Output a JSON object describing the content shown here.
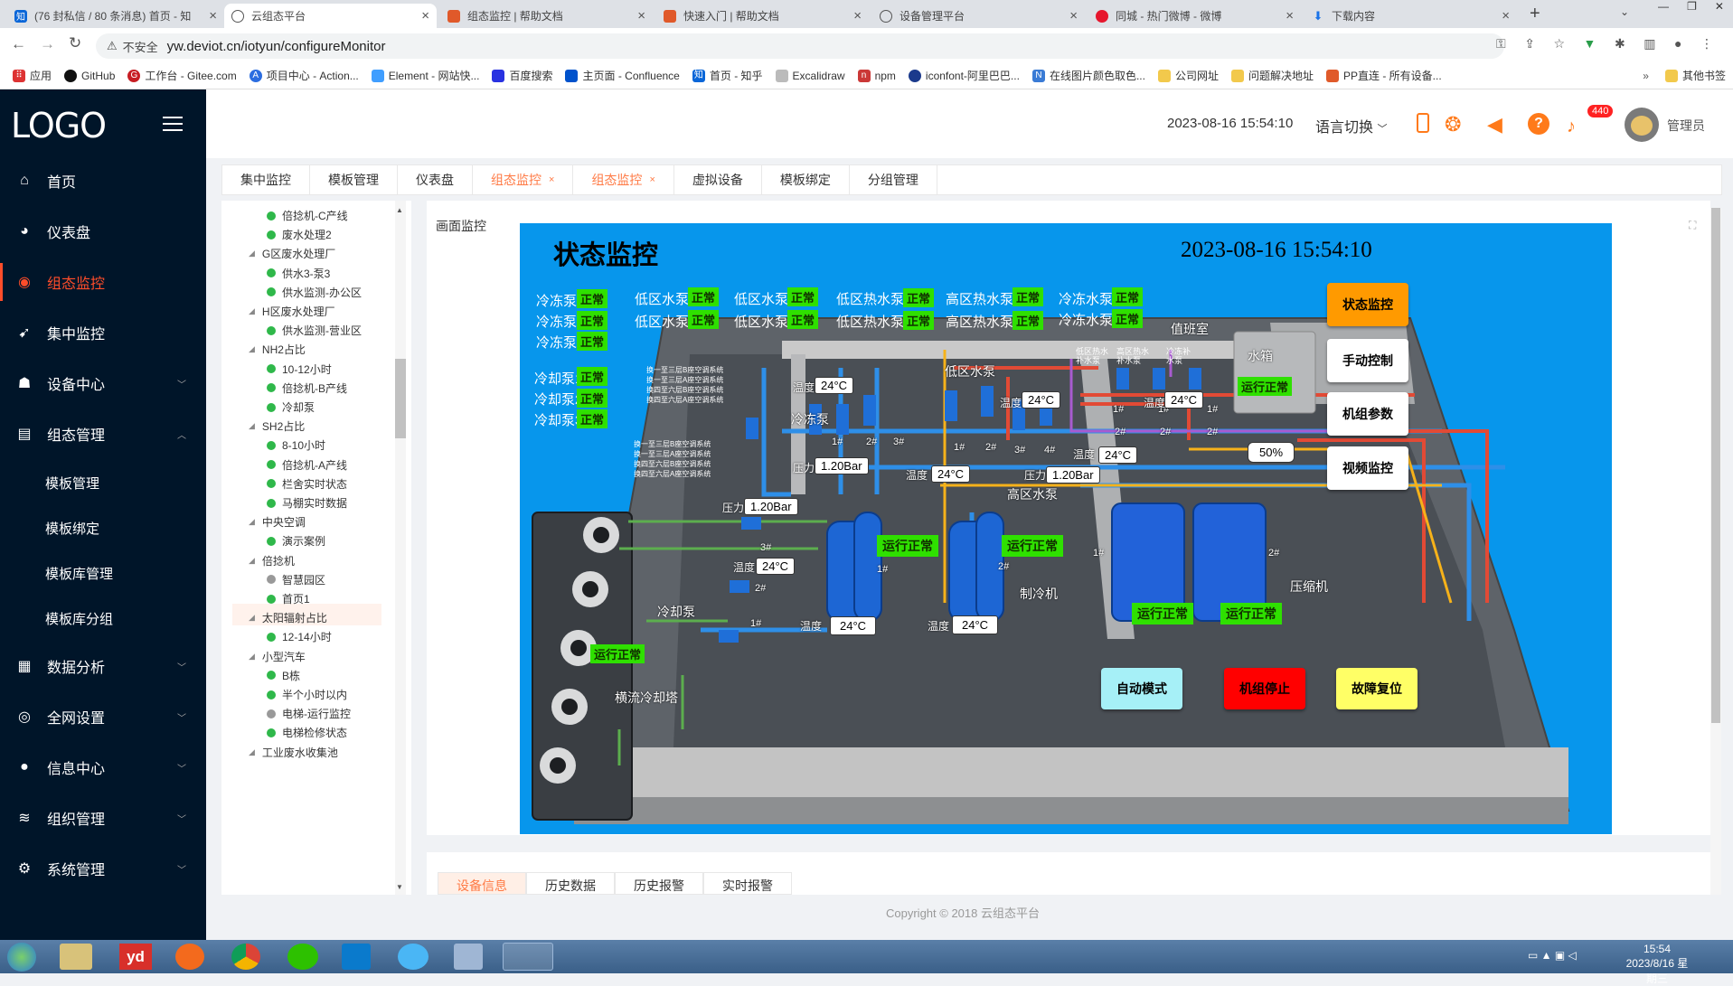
{
  "browser": {
    "tabs": [
      {
        "label": "(76 封私信 / 80 条消息) 首页 - 知",
        "active": false
      },
      {
        "label": "云组态平台",
        "active": true
      },
      {
        "label": "组态监控 | 帮助文档",
        "active": false
      },
      {
        "label": "快速入门 | 帮助文档",
        "active": false
      },
      {
        "label": "设备管理平台",
        "active": false
      },
      {
        "label": "同城 - 热门微博 - 微博",
        "active": false
      },
      {
        "label": "下载内容",
        "active": false
      }
    ],
    "security": "不安全",
    "url": "yw.deviot.cn/iotyun/configureMonitor",
    "bookmarks": [
      "应用",
      "GitHub",
      "工作台 - Gitee.com",
      "项目中心 - Action...",
      "Element - 网站快...",
      "百度搜索",
      "主页面 - Confluence",
      "首页 - 知乎",
      "Excalidraw",
      "npm",
      "iconfont-阿里巴巴...",
      "在线图片颜色取色...",
      "公司网址",
      "问题解决地址",
      "PP直连 - 所有设备..."
    ],
    "bookmarks_other": "其他书签"
  },
  "sidebar": {
    "logo": "LOGO",
    "items": [
      {
        "label": "首页",
        "icon": "home-icon"
      },
      {
        "label": "仪表盘",
        "icon": "dashboard-icon"
      },
      {
        "label": "组态监控",
        "icon": "monitor-icon"
      },
      {
        "label": "集中监控",
        "icon": "central-monitor-icon"
      },
      {
        "label": "设备中心",
        "icon": "device-icon"
      },
      {
        "label": "组态管理",
        "icon": "config-icon"
      },
      {
        "label": "数据分析",
        "icon": "analysis-icon"
      },
      {
        "label": "全网设置",
        "icon": "network-icon"
      },
      {
        "label": "信息中心",
        "icon": "message-icon"
      },
      {
        "label": "组织管理",
        "icon": "org-icon"
      },
      {
        "label": "系统管理",
        "icon": "settings-icon"
      }
    ],
    "subitems": [
      "模板管理",
      "模板绑定",
      "模板库管理",
      "模板库分组"
    ]
  },
  "header": {
    "datetime": "2023-08-16 15:54:10",
    "language": "语言切换",
    "badge": "440",
    "user": "管理员"
  },
  "tags": [
    {
      "label": "集中监控",
      "closable": false,
      "hl": false
    },
    {
      "label": "模板管理",
      "closable": false,
      "hl": false
    },
    {
      "label": "仪表盘",
      "closable": false,
      "hl": false
    },
    {
      "label": "组态监控",
      "closable": true,
      "hl": true
    },
    {
      "label": "组态监控",
      "closable": true,
      "hl": true
    },
    {
      "label": "虚拟设备",
      "closable": false,
      "hl": false
    },
    {
      "label": "模板绑定",
      "closable": false,
      "hl": false
    },
    {
      "label": "分组管理",
      "closable": false,
      "hl": false
    }
  ],
  "tree": [
    {
      "t": "倍捻机-C产线",
      "lv": 2,
      "dot": "green"
    },
    {
      "t": "废水处理2",
      "lv": 2,
      "dot": "green"
    },
    {
      "t": "G区废水处理厂",
      "lv": 1
    },
    {
      "t": "供水3-泵3",
      "lv": 2,
      "dot": "green"
    },
    {
      "t": "供水监测-办公区",
      "lv": 2,
      "dot": "green"
    },
    {
      "t": "H区废水处理厂",
      "lv": 1
    },
    {
      "t": "供水监测-营业区",
      "lv": 2,
      "dot": "green"
    },
    {
      "t": "NH2占比",
      "lv": 1
    },
    {
      "t": "10-12小时",
      "lv": 2,
      "dot": "green"
    },
    {
      "t": "倍捻机-B产线",
      "lv": 2,
      "dot": "green"
    },
    {
      "t": "冷却泵",
      "lv": 2,
      "dot": "green"
    },
    {
      "t": "SH2占比",
      "lv": 1
    },
    {
      "t": "8-10小时",
      "lv": 2,
      "dot": "green"
    },
    {
      "t": "倍捻机-A产线",
      "lv": 2,
      "dot": "green"
    },
    {
      "t": "栏舍实时状态",
      "lv": 2,
      "dot": "green"
    },
    {
      "t": "马棚实时数据",
      "lv": 2,
      "dot": "green"
    },
    {
      "t": "中央空调",
      "lv": 1
    },
    {
      "t": "演示案例",
      "lv": 2,
      "dot": "green",
      "sel": true
    },
    {
      "t": "倍捻机",
      "lv": 1
    },
    {
      "t": "智慧园区",
      "lv": 2,
      "dot": "gray"
    },
    {
      "t": "首页1",
      "lv": 2,
      "dot": "green"
    },
    {
      "t": "太阳辐射占比",
      "lv": 1
    },
    {
      "t": "12-14小时",
      "lv": 2,
      "dot": "green"
    },
    {
      "t": "小型汽车",
      "lv": 1
    },
    {
      "t": "B栋",
      "lv": 2,
      "dot": "green"
    },
    {
      "t": "半个小时以内",
      "lv": 2,
      "dot": "green"
    },
    {
      "t": "电梯-运行监控",
      "lv": 2,
      "dot": "gray"
    },
    {
      "t": "电梯检修状态",
      "lv": 2,
      "dot": "green"
    },
    {
      "t": "工业废水收集池",
      "lv": 1
    }
  ],
  "content": {
    "panel_title": "画面监控",
    "scada": {
      "title": "状态监控",
      "datetime": "2023-08-16 15:54:10",
      "status_ok": "正常",
      "running": "运行正常",
      "pumps": [
        "冷冻泵1",
        "冷冻泵2",
        "冷冻泵3",
        "冷却泵1",
        "冷却泵2",
        "冷却泵3",
        "低区水泵1",
        "低区水泵2",
        "低区水泵3",
        "低区水泵4",
        "低区热水泵1",
        "低区热水泵2",
        "高区热水泵1",
        "高区热水泵2",
        "冷冻水泵1",
        "冷冻水泵2"
      ],
      "area_labels": [
        "冷冻泵",
        "低区水泵",
        "高区水泵",
        "冷却泵",
        "制冷机",
        "压缩机",
        "值班室",
        "水箱",
        "横流冷却塔"
      ],
      "small_labels": [
        "低区热水补水泵",
        "高区热水补水泵",
        "冷冻补水泵"
      ],
      "pipe_notes": [
        "换一至三层B座空调系统",
        "换一至三层A座空调系统",
        "换四至六层B座空调系统",
        "换四至六层A座空调系统"
      ],
      "temp_label": "温度",
      "pressure_label": "压力",
      "level_label": "水位",
      "temp_value": "24°C",
      "pressure_value": "1.20Bar",
      "level_value": "50%",
      "unit_numbers": [
        "1#",
        "2#",
        "3#",
        "4#"
      ],
      "side_buttons": [
        "状态监控",
        "手动控制",
        "机组参数",
        "视频监控"
      ],
      "bottom_buttons": [
        "自动模式",
        "机组停止",
        "故障复位"
      ]
    },
    "bottom_tabs": [
      "设备信息",
      "历史数据",
      "历史报警",
      "实时报警"
    ],
    "footer": "Copyright © 2018 云组态平台"
  },
  "taskbar": {
    "time": "15:54",
    "date": "2023/8/16 星期三"
  }
}
